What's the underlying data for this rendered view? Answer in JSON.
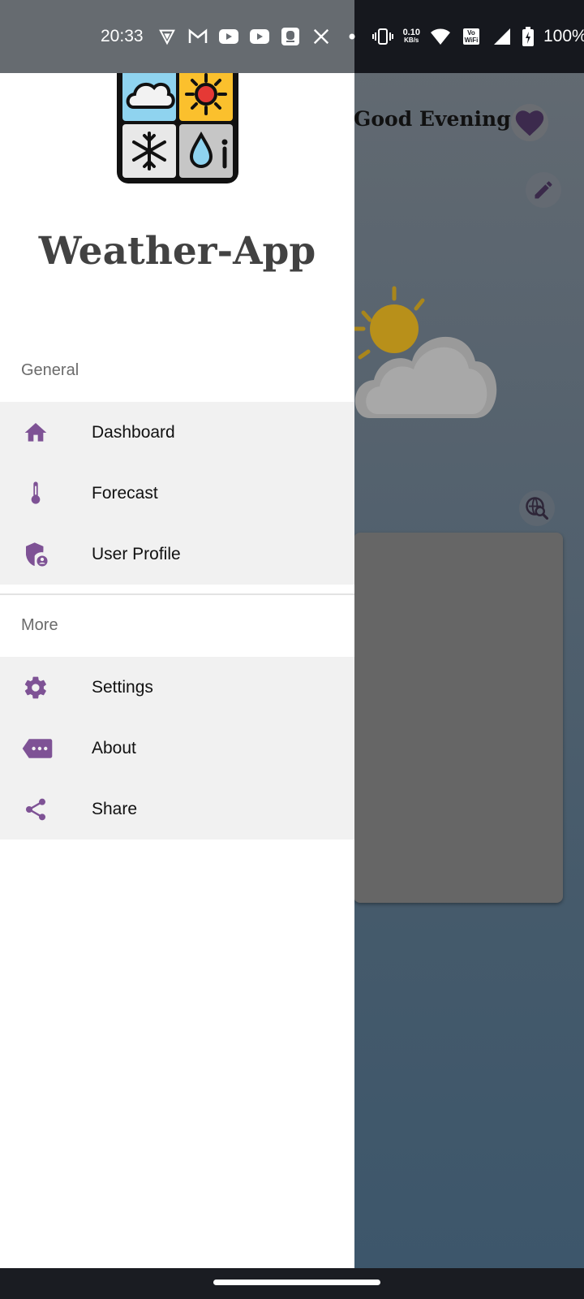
{
  "status_bar": {
    "time": "20:33",
    "net_speed_value": "0.10",
    "net_speed_unit": "KB/s",
    "vowifi_top": "Vo",
    "vowifi_bottom": "WiFi",
    "battery": "100%",
    "notification_icons": [
      "vpn-icon",
      "gmail-icon",
      "youtube-icon",
      "youtube-icon",
      "app-icon",
      "x-icon"
    ]
  },
  "background": {
    "greeting": "Good Evening"
  },
  "drawer": {
    "app_title": "Weather-App",
    "sections": [
      {
        "label": "General",
        "items": [
          {
            "label": "Dashboard",
            "icon": "home-icon"
          },
          {
            "label": "Forecast",
            "icon": "thermometer-icon"
          },
          {
            "label": "User Profile",
            "icon": "shield-user-icon"
          }
        ]
      },
      {
        "label": "More",
        "items": [
          {
            "label": "Settings",
            "icon": "gear-icon"
          },
          {
            "label": "About",
            "icon": "more-tag-icon"
          },
          {
            "label": "Share",
            "icon": "share-icon"
          }
        ]
      }
    ]
  },
  "colors": {
    "accent": "#7e5295",
    "menu_bg": "#f1f1f1",
    "drawer_bg": "#ffffff"
  }
}
